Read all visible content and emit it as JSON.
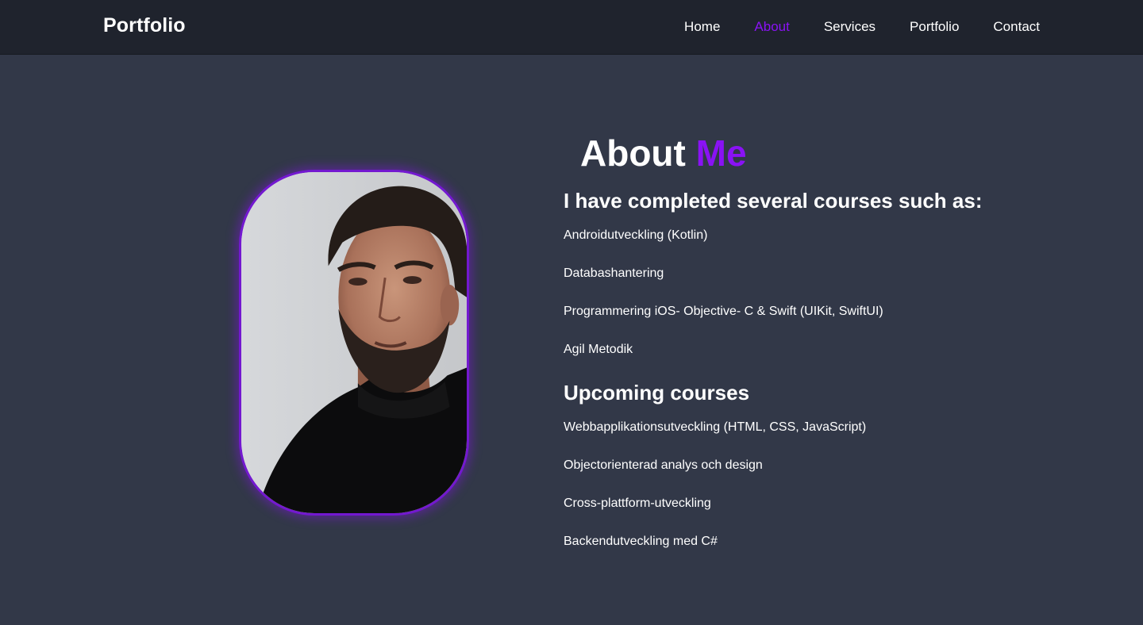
{
  "nav": {
    "logo": "Portfolio",
    "links": [
      {
        "label": "Home",
        "active": false
      },
      {
        "label": "About",
        "active": true
      },
      {
        "label": "Services",
        "active": false
      },
      {
        "label": "Portfolio",
        "active": false
      },
      {
        "label": "Contact",
        "active": false
      }
    ]
  },
  "about": {
    "title_prefix": "About",
    "title_accent": "Me",
    "completed_heading": "I have completed several courses such as:",
    "completed_courses": [
      "Androidutveckling (Kotlin)",
      "Databashantering",
      "Programmering iOS- Objective- C & Swift (UIKit, SwiftUI)",
      "Agil Metodik"
    ],
    "upcoming_heading": "Upcoming courses",
    "upcoming_courses": [
      "Webbapplikationsutveckling (HTML, CSS, JavaScript)",
      "Objectorienterad analys och design",
      "Cross-plattform-utveckling",
      "Backendutveckling med C#"
    ]
  },
  "colors": {
    "accent": "#8a12f5",
    "background": "#323848",
    "navbar": "#1f232d",
    "text": "#ffffff"
  }
}
